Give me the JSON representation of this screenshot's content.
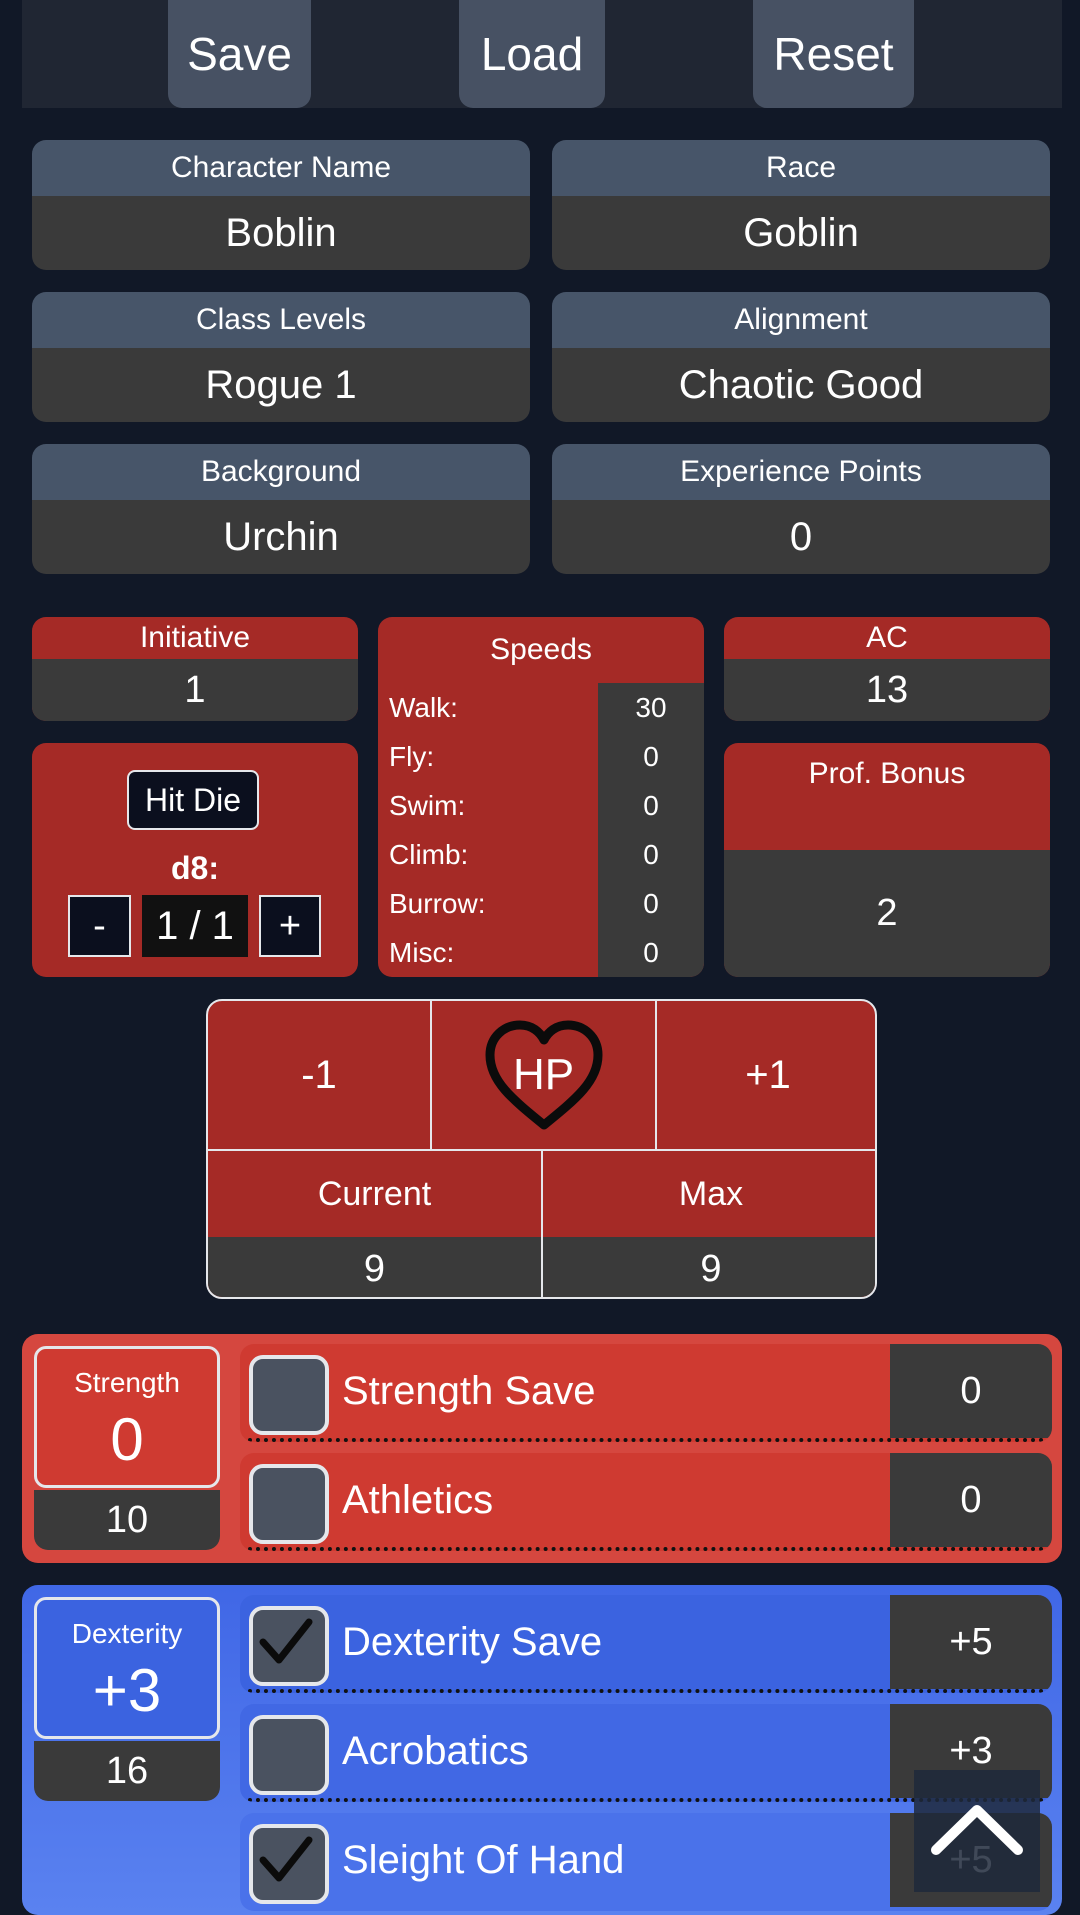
{
  "toolbar": {
    "save": "Save",
    "load": "Load",
    "reset": "Reset"
  },
  "info": {
    "character_name": {
      "label": "Character Name",
      "value": "Boblin"
    },
    "race": {
      "label": "Race",
      "value": "Goblin"
    },
    "class_levels": {
      "label": "Class Levels",
      "value": "Rogue 1"
    },
    "alignment": {
      "label": "Alignment",
      "value": "Chaotic Good"
    },
    "background": {
      "label": "Background",
      "value": "Urchin"
    },
    "experience": {
      "label": "Experience Points",
      "value": "0"
    }
  },
  "initiative": {
    "label": "Initiative",
    "value": "1"
  },
  "ac": {
    "label": "AC",
    "value": "13"
  },
  "speeds": {
    "title": "Speeds",
    "rows": [
      {
        "label": "Walk:",
        "value": "30"
      },
      {
        "label": "Fly:",
        "value": "0"
      },
      {
        "label": "Swim:",
        "value": "0"
      },
      {
        "label": "Climb:",
        "value": "0"
      },
      {
        "label": "Burrow:",
        "value": "0"
      },
      {
        "label": "Misc:",
        "value": "0"
      }
    ]
  },
  "hit_die": {
    "button": "Hit Die",
    "die": "d8:",
    "minus": "-",
    "count": "1 / 1",
    "plus": "+"
  },
  "prof_bonus": {
    "label": "Prof. Bonus",
    "value": "2"
  },
  "hp": {
    "minus": "-1",
    "icon_label": "HP",
    "plus": "+1",
    "current_label": "Current",
    "max_label": "Max",
    "current": "9",
    "max": "9"
  },
  "strength": {
    "name": "Strength",
    "modifier": "0",
    "score": "10",
    "skills": [
      {
        "name": "Strength Save",
        "value": "0",
        "checked": false
      },
      {
        "name": "Athletics",
        "value": "0",
        "checked": false
      }
    ]
  },
  "dexterity": {
    "name": "Dexterity",
    "modifier": "+3",
    "score": "16",
    "skills": [
      {
        "name": "Dexterity Save",
        "value": "+5",
        "checked": true
      },
      {
        "name": "Acrobatics",
        "value": "+3",
        "checked": false
      },
      {
        "name": "Sleight Of Hand",
        "value": "+5",
        "checked": true
      }
    ]
  },
  "colors": {
    "background": "#111827",
    "stat_red": "#a52a26",
    "strength_red": "#cf3a31",
    "dexterity_blue": "#3b63e0",
    "value_gray": "#3a3a3a",
    "label_slate": "#475569"
  },
  "icons": {
    "hp": "heart-icon",
    "scroll_top": "chevron-up-icon",
    "checked": "check-icon"
  }
}
